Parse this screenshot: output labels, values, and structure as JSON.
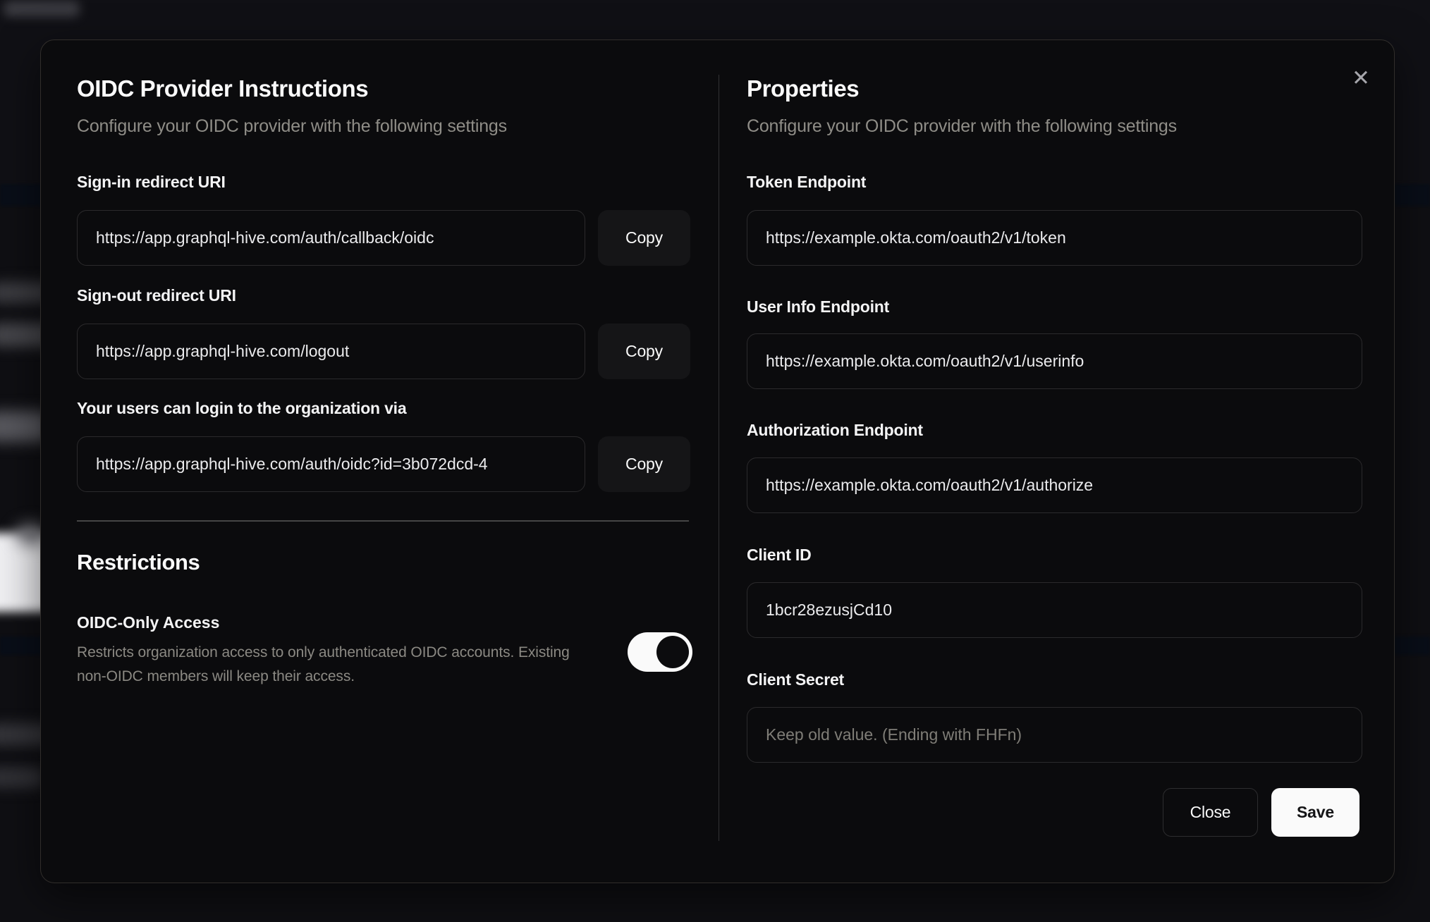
{
  "colors": {
    "modal_background": "#0b0b0d",
    "primary_action": "#fafafa",
    "toggle_on_track": "#fafafa",
    "toggle_thumb": "#0c0c0e"
  },
  "modal": {
    "close_icon_glyph": "✕",
    "left": {
      "title": "OIDC Provider Instructions",
      "subtitle": "Configure your OIDC provider with the following settings",
      "fields": [
        {
          "label": "Sign-in redirect URI",
          "value": "https://app.graphql-hive.com/auth/callback/oidc",
          "copy_label": "Copy"
        },
        {
          "label": "Sign-out redirect URI",
          "value": "https://app.graphql-hive.com/logout",
          "copy_label": "Copy"
        },
        {
          "label": "Your users can login to the organization via",
          "value": "https://app.graphql-hive.com/auth/oidc?id=3b072dcd-4",
          "copy_label": "Copy"
        }
      ],
      "restrictions": {
        "title": "Restrictions",
        "toggle_label": "OIDC-Only Access",
        "toggle_description": "Restricts organization access to only authenticated OIDC accounts. Existing non-OIDC members will keep their access.",
        "toggle_state": "on"
      }
    },
    "right": {
      "title": "Properties",
      "subtitle": "Configure your OIDC provider with the following settings",
      "fields": [
        {
          "label": "Token Endpoint",
          "value": "https://example.okta.com/oauth2/v1/token"
        },
        {
          "label": "User Info Endpoint",
          "value": "https://example.okta.com/oauth2/v1/userinfo"
        },
        {
          "label": "Authorization Endpoint",
          "value": "https://example.okta.com/oauth2/v1/authorize"
        },
        {
          "label": "Client ID",
          "value": "1bcr28ezusjCd10"
        },
        {
          "label": "Client Secret",
          "value": "",
          "placeholder": "Keep old value. (Ending with FHFn)"
        }
      ],
      "buttons": {
        "close": "Close",
        "save": "Save"
      }
    }
  }
}
